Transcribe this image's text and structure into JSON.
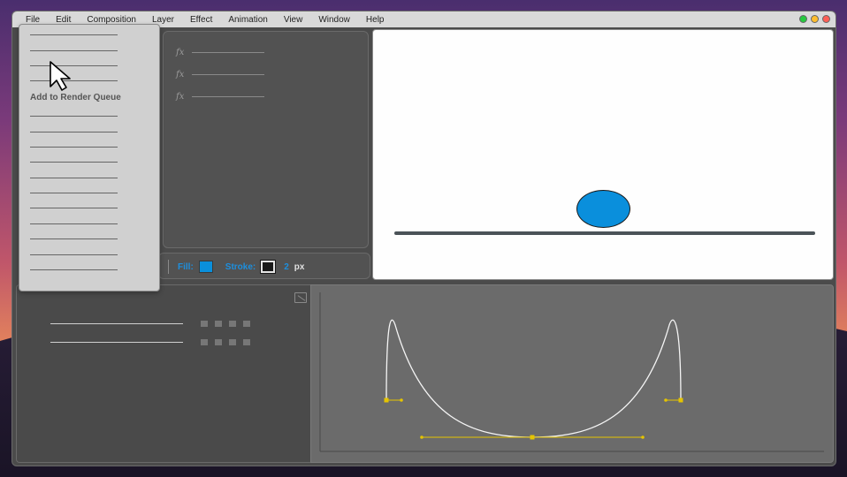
{
  "menubar": {
    "items": [
      "File",
      "Edit",
      "Composition",
      "Layer",
      "Effect",
      "Animation",
      "View",
      "Window",
      "Help"
    ]
  },
  "window_controls": {
    "icons": [
      "green-dot-icon",
      "yellow-dot-icon",
      "red-dot-icon"
    ]
  },
  "file_menu": {
    "highlighted_item": "Add to Render Queue"
  },
  "effects": {
    "icon_label": "fx",
    "rows": [
      "fx",
      "fx",
      "fx"
    ]
  },
  "properties": {
    "fill_label": "Fill:",
    "fill_color": "#0a8fdc",
    "stroke_label": "Stroke:",
    "stroke_color": "#1a1a1a",
    "stroke_width": "2",
    "stroke_unit": "px"
  },
  "viewer": {
    "ball_color": "#0a8fdc",
    "ground_color": "#4b5358"
  },
  "graph": {
    "curve_color": "#f5f5f5",
    "handle_color": "#e5c400"
  },
  "colors": {
    "accent": "#1d8fde",
    "panel": "#525252"
  }
}
